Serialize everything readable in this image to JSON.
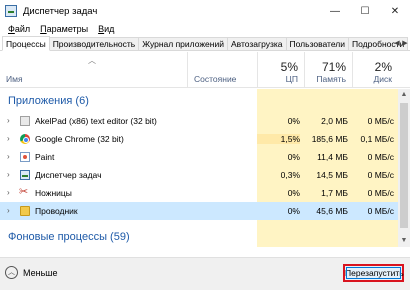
{
  "window": {
    "title": "Диспетчер задач",
    "controls": [
      "—",
      "☐",
      "✕"
    ]
  },
  "menu": [
    {
      "pre": "",
      "u": "Ф",
      "post": "айл"
    },
    {
      "pre": "",
      "u": "П",
      "post": "араметры"
    },
    {
      "pre": "",
      "u": "В",
      "post": "ид"
    }
  ],
  "tabs": [
    "Процессы",
    "Производительность",
    "Журнал приложений",
    "Автозагрузка",
    "Пользователи",
    "Подробности"
  ],
  "columns": {
    "name": "Имя",
    "status": "Состояние",
    "cpu": {
      "pct": "5%",
      "label": "ЦП"
    },
    "memory": {
      "pct": "71%",
      "label": "Память"
    },
    "disk": {
      "pct": "2%",
      "label": "Диск"
    }
  },
  "groups": {
    "apps": "Приложения (6)",
    "background": "Фоновые процессы (59)"
  },
  "rows": [
    {
      "name": "AkelPad (x86) text editor (32 bit)",
      "icon": "akelpad-icon",
      "cpu": "0%",
      "mem": "2,0 МБ",
      "disk": "0 МБ/с"
    },
    {
      "name": "Google Chrome (32 bit)",
      "icon": "chrome-icon",
      "cpu": "1,5%",
      "mem": "185,6 МБ",
      "disk": "0,1 МБ/с"
    },
    {
      "name": "Paint",
      "icon": "paint-icon",
      "cpu": "0%",
      "mem": "11,4 МБ",
      "disk": "0 МБ/с"
    },
    {
      "name": "Диспетчер задач",
      "icon": "task-manager-icon",
      "cpu": "0,3%",
      "mem": "14,5 МБ",
      "disk": "0 МБ/с"
    },
    {
      "name": "Ножницы",
      "icon": "scissors-icon",
      "cpu": "0%",
      "mem": "1,7 МБ",
      "disk": "0 МБ/с"
    },
    {
      "name": "Проводник",
      "icon": "explorer-folder-icon",
      "cpu": "0%",
      "mem": "45,6 МБ",
      "disk": "0 МБ/с"
    }
  ],
  "footer": {
    "less": "Меньше",
    "restart": "Перезапустить"
  }
}
